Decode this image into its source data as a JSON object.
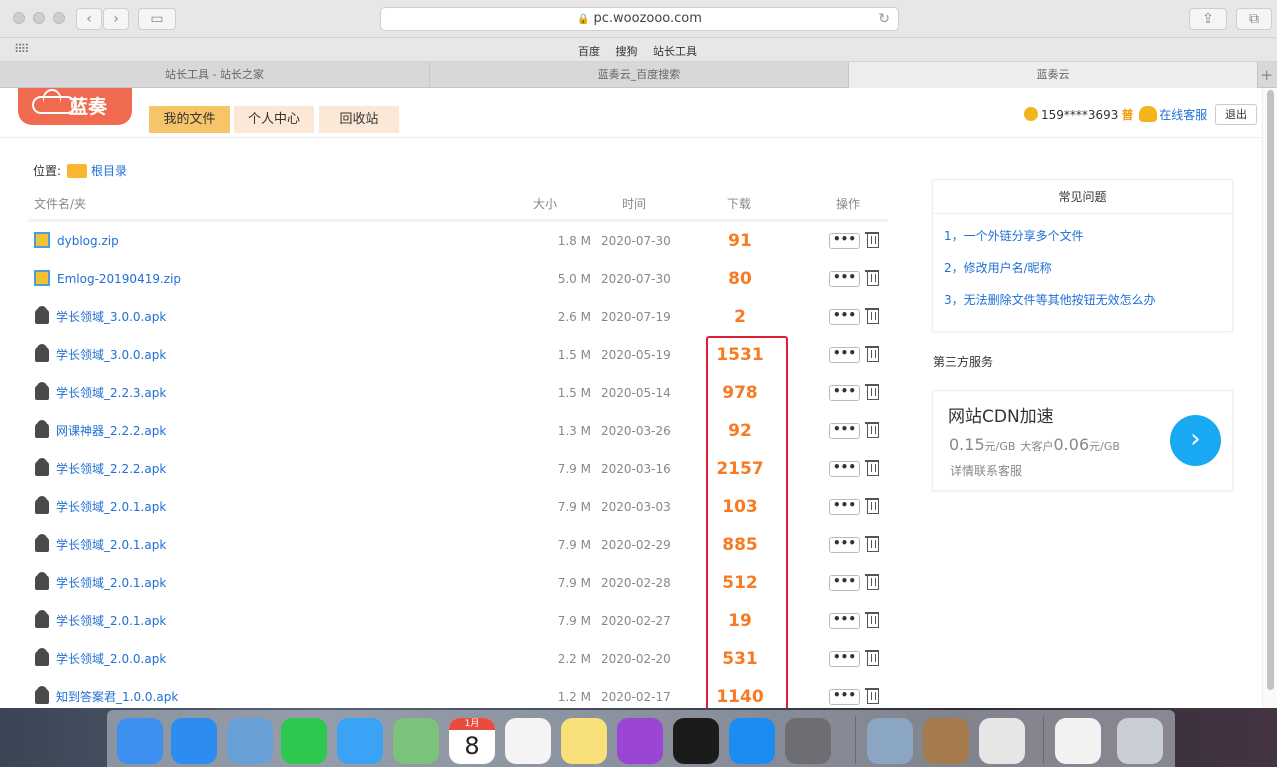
{
  "browser": {
    "url": "pc.woozooo.com",
    "favorites": [
      "百度",
      "搜狗",
      "站长工具"
    ],
    "tabs": [
      "站长工具 - 站长之家",
      "蓝奏云_百度搜索",
      "蓝奏云"
    ],
    "active_tab": 2
  },
  "site": {
    "logo_text": "蓝奏",
    "nav": [
      "我的文件",
      "个人中心",
      "回收站"
    ],
    "user": {
      "phone": "159****3693",
      "level": "普",
      "service_link": "在线客服",
      "logout": "退出"
    }
  },
  "location": {
    "label": "位置:",
    "root": "根目录"
  },
  "table": {
    "headers": {
      "name": "文件名/夹",
      "size": "大小",
      "time": "时间",
      "downloads": "下载",
      "actions": "操作"
    },
    "more_label": "•••",
    "rows": [
      {
        "name": "dyblog.zip",
        "icon": "zip-file-icon",
        "size": "1.8 M",
        "date": "2020-07-30",
        "downloads": "91"
      },
      {
        "name": "Emlog-20190419.zip",
        "icon": "zip-file-icon",
        "size": "5.0 M",
        "date": "2020-07-30",
        "downloads": "80"
      },
      {
        "name": "学长领域_3.0.0.apk",
        "icon": "android-icon",
        "size": "2.6 M",
        "date": "2020-07-19",
        "downloads": "2"
      },
      {
        "name": "学长领域_3.0.0.apk",
        "icon": "android-icon",
        "size": "1.5 M",
        "date": "2020-05-19",
        "downloads": "1531"
      },
      {
        "name": "学长领域_2.2.3.apk",
        "icon": "android-icon",
        "size": "1.5 M",
        "date": "2020-05-14",
        "downloads": "978"
      },
      {
        "name": "网课神器_2.2.2.apk",
        "icon": "android-icon",
        "size": "1.3 M",
        "date": "2020-03-26",
        "downloads": "92"
      },
      {
        "name": "学长领域_2.2.2.apk",
        "icon": "android-icon",
        "size": "7.9 M",
        "date": "2020-03-16",
        "downloads": "2157"
      },
      {
        "name": "学长领域_2.0.1.apk",
        "icon": "android-icon",
        "size": "7.9 M",
        "date": "2020-03-03",
        "downloads": "103"
      },
      {
        "name": "学长领域_2.0.1.apk",
        "icon": "android-icon",
        "size": "7.9 M",
        "date": "2020-02-29",
        "downloads": "885"
      },
      {
        "name": "学长领域_2.0.1.apk",
        "icon": "android-icon",
        "size": "7.9 M",
        "date": "2020-02-28",
        "downloads": "512"
      },
      {
        "name": "学长领域_2.0.1.apk",
        "icon": "android-icon",
        "size": "7.9 M",
        "date": "2020-02-27",
        "downloads": "19"
      },
      {
        "name": "学长领域_2.0.0.apk",
        "icon": "android-icon",
        "size": "2.2 M",
        "date": "2020-02-20",
        "downloads": "531"
      },
      {
        "name": "知到答案君_1.0.0.apk",
        "icon": "android-icon",
        "size": "1.2 M",
        "date": "2020-02-17",
        "downloads": "1140"
      }
    ]
  },
  "faq": {
    "title": "常见问题",
    "items": [
      "1，一个外链分享多个文件",
      "2，修改用户名/昵称",
      "3，无法删除文件等其他按钮无效怎么办"
    ]
  },
  "third_party": {
    "title": "第三方服务",
    "cdn_title": "网站CDN加速",
    "price_main": "0.15",
    "price_unit": "元/GB",
    "big_client": "大客户",
    "price_big": "0.06",
    "price_big_unit": "元/GB",
    "note": "详情联系客服",
    "go_symbol": "›"
  },
  "dock": {
    "apps": [
      {
        "name": "finder-icon",
        "color": "#3d8ff0"
      },
      {
        "name": "safari-icon",
        "color": "#2d8cf0"
      },
      {
        "name": "mail-icon",
        "color": "#6aa0d8"
      },
      {
        "name": "facetime-icon",
        "color": "#2dc84d"
      },
      {
        "name": "messages-icon",
        "color": "#3aa3f5"
      },
      {
        "name": "maps-icon",
        "color": "#7cc27a"
      },
      {
        "name": "calendar-icon",
        "color": "#ffffff"
      },
      {
        "name": "reminders-icon",
        "color": "#f4f4f4"
      },
      {
        "name": "notes-icon",
        "color": "#f8e07a"
      },
      {
        "name": "podcasts-icon",
        "color": "#9b45d4"
      },
      {
        "name": "appletv-icon",
        "color": "#1b1b1b"
      },
      {
        "name": "appstore-icon",
        "color": "#1c8cf2"
      },
      {
        "name": "system-preferences-icon",
        "color": "#6e6e72"
      },
      {
        "name": "preview-icon",
        "color": "#8aa6c2"
      },
      {
        "name": "contacts-icon",
        "color": "#a57b4e"
      },
      {
        "name": "qq-icon",
        "color": "#e6e6e6"
      },
      {
        "name": "finder-window-icon",
        "color": "#f2f2f2"
      },
      {
        "name": "trash-icon",
        "color": "#c9ced5"
      }
    ],
    "calendar_month": "1月",
    "calendar_day": "8"
  },
  "colors": {
    "accent": "#f77b22",
    "link": "#1f6fd6",
    "highlight_box": "#e01c37",
    "nav_active": "#f6c56a",
    "nav_inactive": "#fbe8d6"
  }
}
